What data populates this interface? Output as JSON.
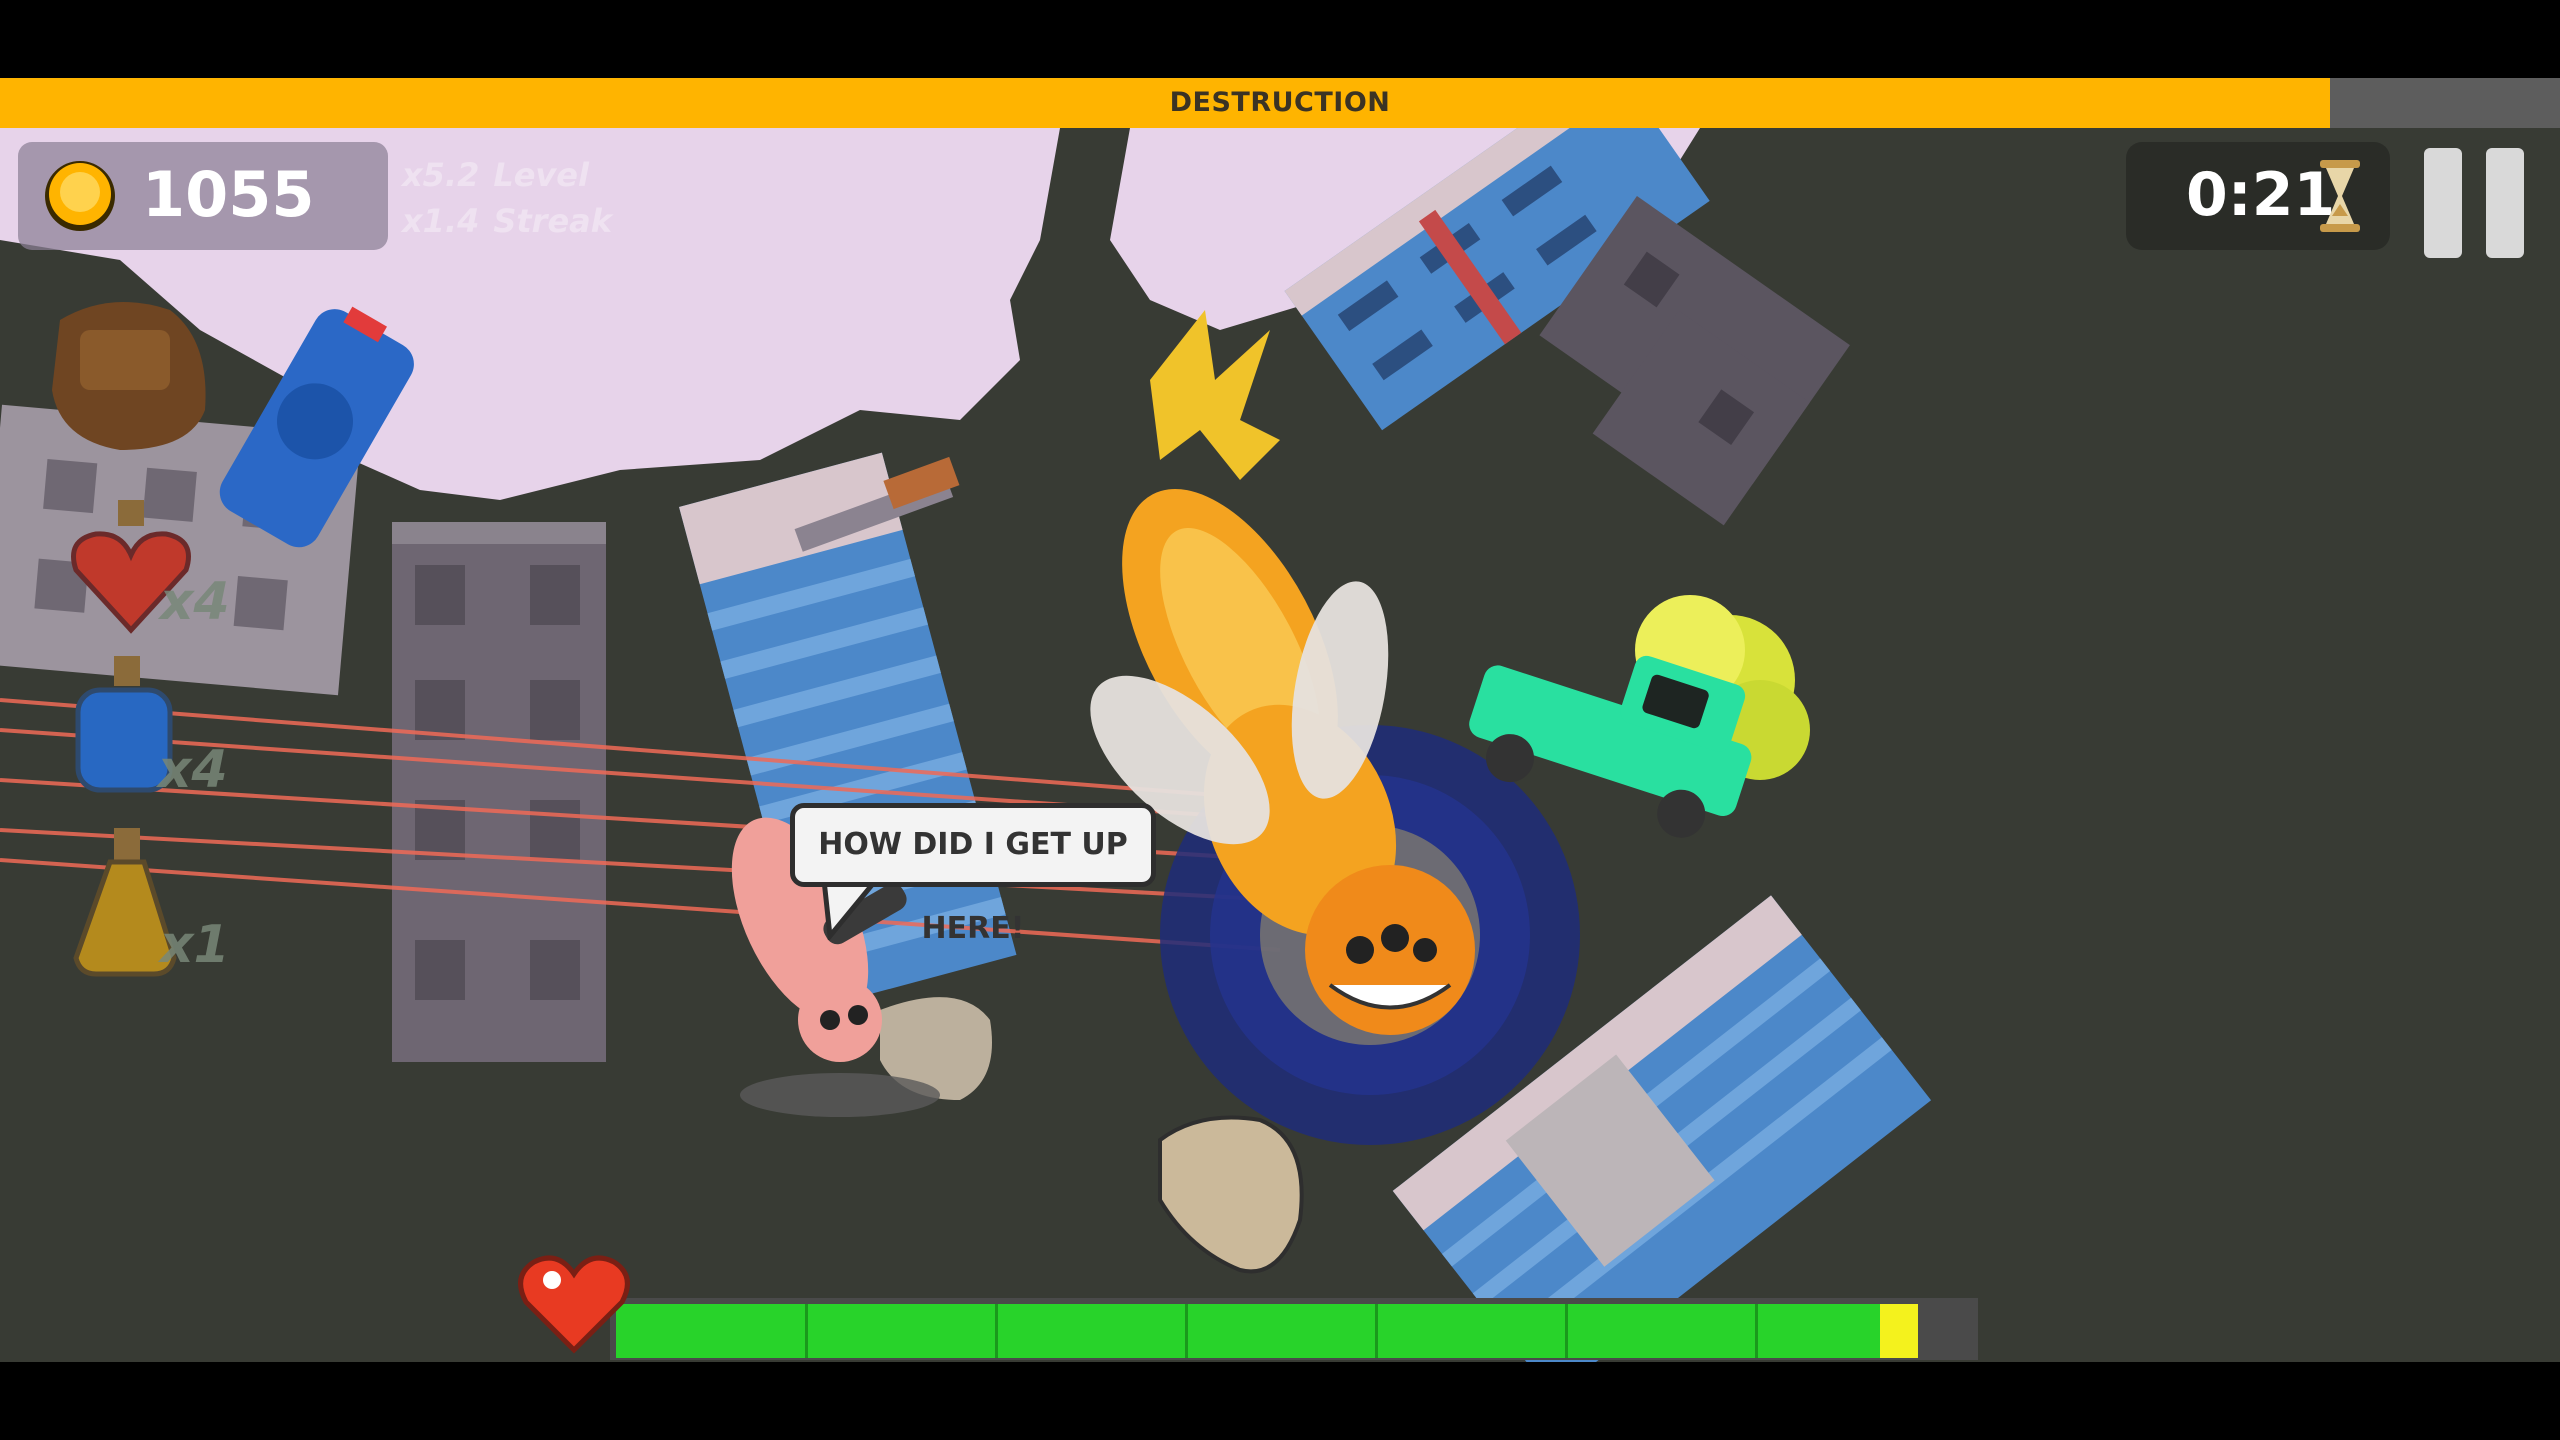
{
  "colors": {
    "destruction_fill": "#ffb400",
    "health_fill": "#28d32a",
    "health_tip": "#f4f21d",
    "background": "#383b34"
  },
  "destruction_bar": {
    "label": "DESTRUCTION",
    "progress": 0.91
  },
  "coins": {
    "icon": "coin-icon",
    "count": "1055"
  },
  "multipliers": [
    {
      "value": "x5.2",
      "label": "Level"
    },
    {
      "value": "x1.4",
      "label": "Streak"
    }
  ],
  "timer": {
    "time": "0:21",
    "icon": "hourglass-icon"
  },
  "pause": {
    "icon": "pause-icon"
  },
  "inventory": [
    {
      "name": "backpack",
      "icon": "backpack-icon"
    },
    {
      "name": "heart-potion",
      "icon": "heart-potion-icon",
      "count": "x4"
    },
    {
      "name": "blue-potion",
      "icon": "blue-potion-icon",
      "count": "x4"
    },
    {
      "name": "yellow-potion",
      "icon": "yellow-potion-icon",
      "count": "x1"
    }
  ],
  "speech_bubble": {
    "text": "HOW DID I GET UP HERE!"
  },
  "health_bar": {
    "icon": "heart-icon",
    "health": 0.96
  }
}
